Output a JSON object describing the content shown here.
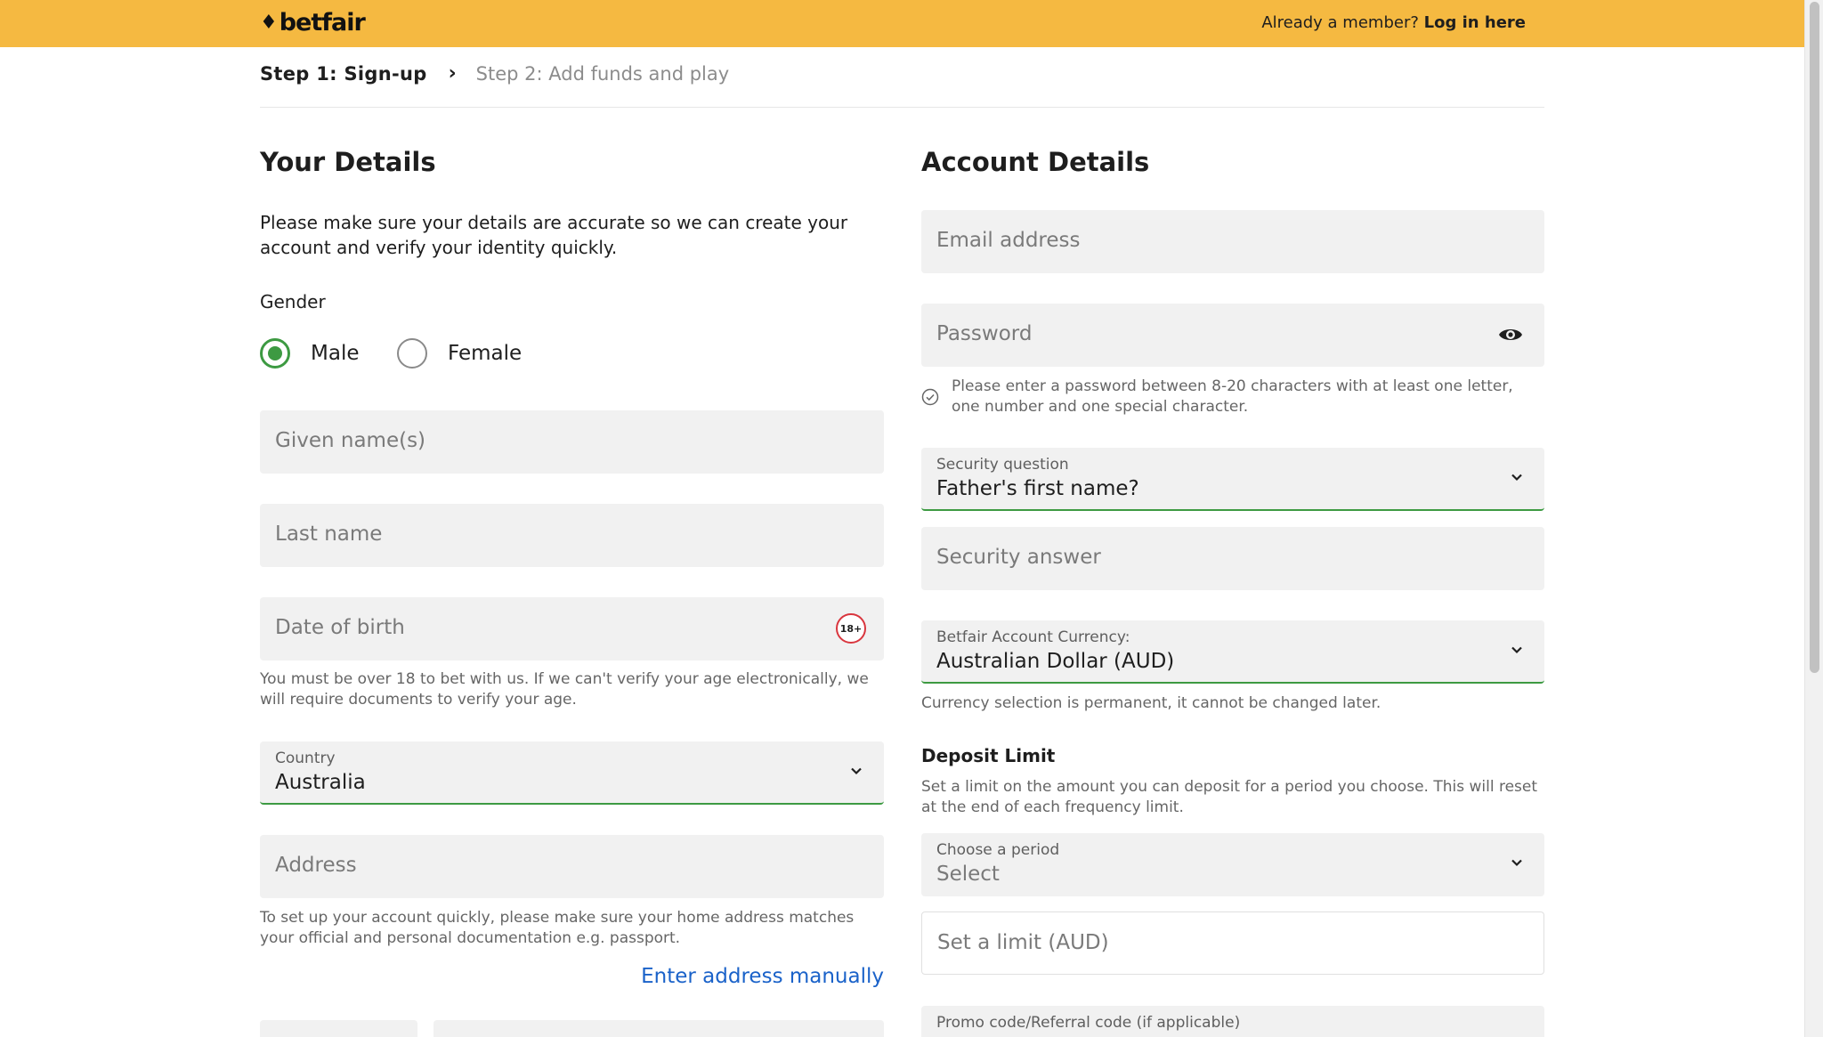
{
  "header": {
    "logo_text": "betfair",
    "member_prompt": "Already a member?",
    "login_link": "Log in here"
  },
  "steps": {
    "step1": "Step 1: Sign-up",
    "step2": "Step 2: Add funds and play"
  },
  "your_details": {
    "title": "Your Details",
    "intro": "Please make sure your details are accurate so we can create your account and verify your identity quickly.",
    "gender_label": "Gender",
    "gender_options": [
      "Male",
      "Female"
    ],
    "gender_selected": "Male",
    "given_name_placeholder": "Given name(s)",
    "last_name_placeholder": "Last name",
    "dob_placeholder": "Date of birth",
    "age_badge": "18+",
    "dob_help": "You must be over 18 to bet with us. If we can't verify your age electronically, we will require documents to verify your age.",
    "country_label": "Country",
    "country_value": "Australia",
    "address_placeholder": "Address",
    "address_help": "To set up your account quickly, please make sure your home address matches your official and personal documentation e.g. passport.",
    "enter_manually_link": "Enter address manually"
  },
  "account_details": {
    "title": "Account Details",
    "email_placeholder": "Email address",
    "password_placeholder": "Password",
    "password_help": "Please enter a password between 8-20 characters with at least one letter, one number and one special character.",
    "security_question_label": "Security question",
    "security_question_value": "Father's first name?",
    "security_answer_placeholder": "Security answer",
    "currency_label": "Betfair Account Currency:",
    "currency_value": "Australian Dollar (AUD)",
    "currency_help": "Currency selection is permanent, it cannot be changed later.",
    "deposit_limit_title": "Deposit Limit",
    "deposit_limit_help": "Set a limit on the amount you can deposit for a period you choose.  This will reset at the end of each frequency limit.",
    "period_label": "Choose a period",
    "period_value": "Select",
    "limit_placeholder": "Set a limit (AUD)",
    "promo_label": "Promo code/Referral code (if applicable)"
  },
  "colors": {
    "header_bg": "#f5b941",
    "accent_green": "#3d9a42",
    "link_blue": "#1a62c9",
    "field_bg": "#f1f1f1"
  }
}
